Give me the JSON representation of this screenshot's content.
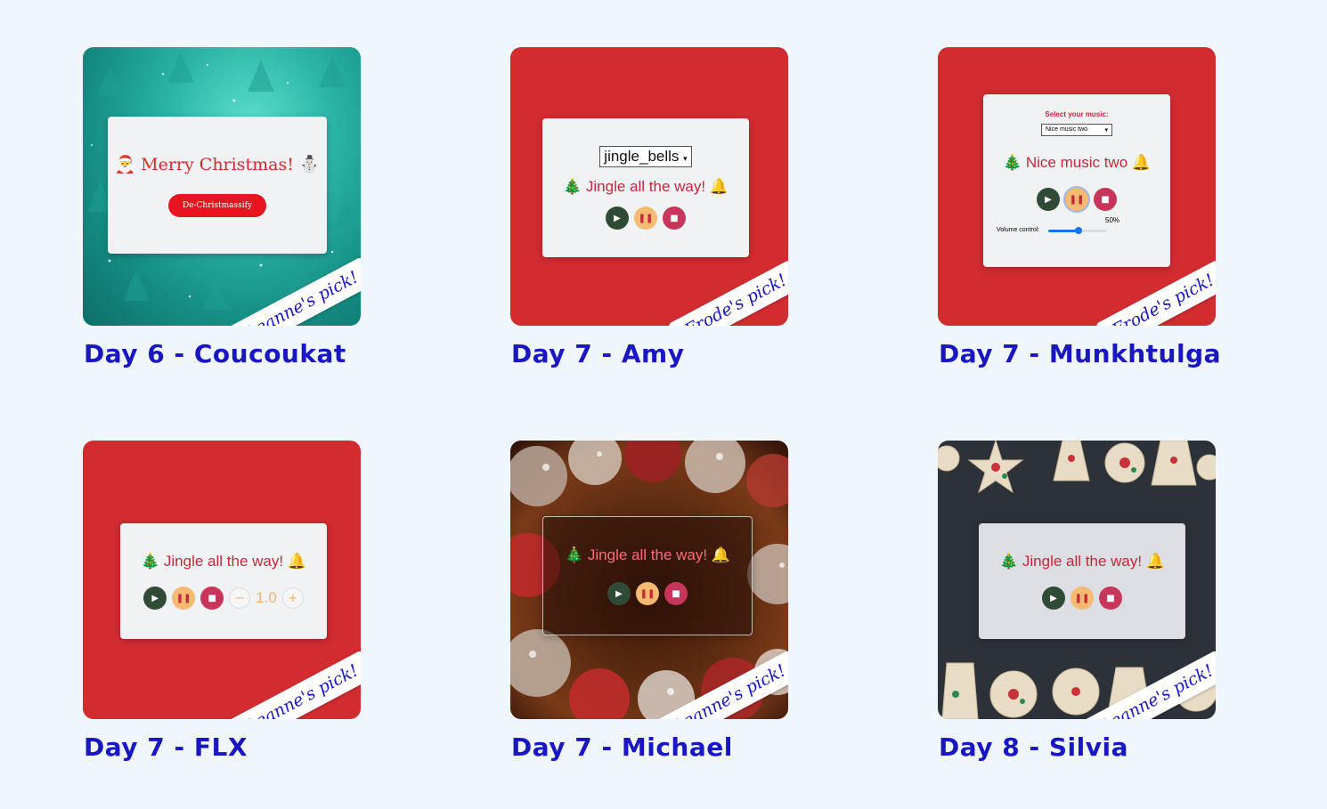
{
  "colors": {
    "page_bg": "#eff6fc",
    "caption": "#1a17c2",
    "card_red": "#d22c31",
    "title_red": "#c3293b"
  },
  "cards": [
    {
      "caption": "Day 6 - Coucoukat",
      "pick": "Leanne's pick!",
      "title": "🎅 Merry Christmas! ⛄",
      "button": "De-Christmassify"
    },
    {
      "caption": "Day 7 - Amy",
      "pick": "Frode's pick!",
      "select": "jingle_bells",
      "title": "🎄 Jingle all the way! 🔔"
    },
    {
      "caption": "Day 7 - Munkhtulga",
      "pick": "Frode's pick!",
      "select_label": "Select your music:",
      "select": "Nice music two",
      "title": "🎄 Nice music two 🔔",
      "volume_label": "Volume control:",
      "volume_value": "50%",
      "volume_level": 0.5
    },
    {
      "caption": "Day 7 - FLX",
      "pick": "Leanne's pick!",
      "title": "🎄 Jingle all the way! 🔔",
      "speed": "1.0"
    },
    {
      "caption": "Day 7 - Michael",
      "pick": "Leanne's pick!",
      "title": "🎄 Jingle all the way! 🔔"
    },
    {
      "caption": "Day 8 - Silvia",
      "pick": "Leanne's pick!",
      "title": "🎄 Jingle all the way! 🔔"
    }
  ],
  "icons": {
    "play": "play-icon",
    "pause": "pause-icon",
    "stop": "stop-icon",
    "minus": "minus-circle-icon",
    "plus": "plus-circle-icon"
  }
}
